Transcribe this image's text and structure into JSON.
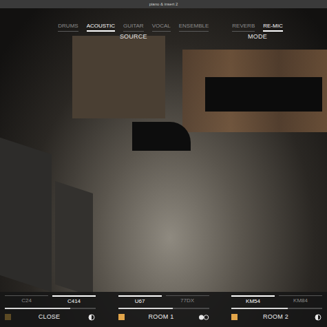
{
  "window": {
    "title": "piano & insert 2"
  },
  "source": {
    "label": "SOURCE",
    "tabs": [
      {
        "label": "DRUMS",
        "selected": false
      },
      {
        "label": "ACOUSTIC",
        "selected": true
      },
      {
        "label": "GUITAR",
        "selected": false
      },
      {
        "label": "VOCAL",
        "selected": false
      },
      {
        "label": "ENSEMBLE",
        "selected": false
      }
    ]
  },
  "mode": {
    "label": "MODE",
    "tabs": [
      {
        "label": "REVERB",
        "selected": false
      },
      {
        "label": "RE-MIC",
        "selected": true
      }
    ]
  },
  "mic_channels": [
    {
      "name": "CLOSE",
      "kind": "mono",
      "level": 0.72,
      "color": "#5c4a24",
      "mics": [
        {
          "label": "C24",
          "selected": false
        },
        {
          "label": "C414",
          "selected": true
        }
      ]
    },
    {
      "name": "ROOM 1",
      "kind": "stereo",
      "level": 0.6,
      "color": "#e2a54a",
      "mics": [
        {
          "label": "U67",
          "selected": true
        },
        {
          "label": "77DX",
          "selected": false
        }
      ]
    },
    {
      "name": "ROOM 2",
      "kind": "mono",
      "level": 0.62,
      "color": "#e2a54a",
      "mics": [
        {
          "label": "KM54",
          "selected": true
        },
        {
          "label": "KM84",
          "selected": false
        }
      ]
    }
  ]
}
